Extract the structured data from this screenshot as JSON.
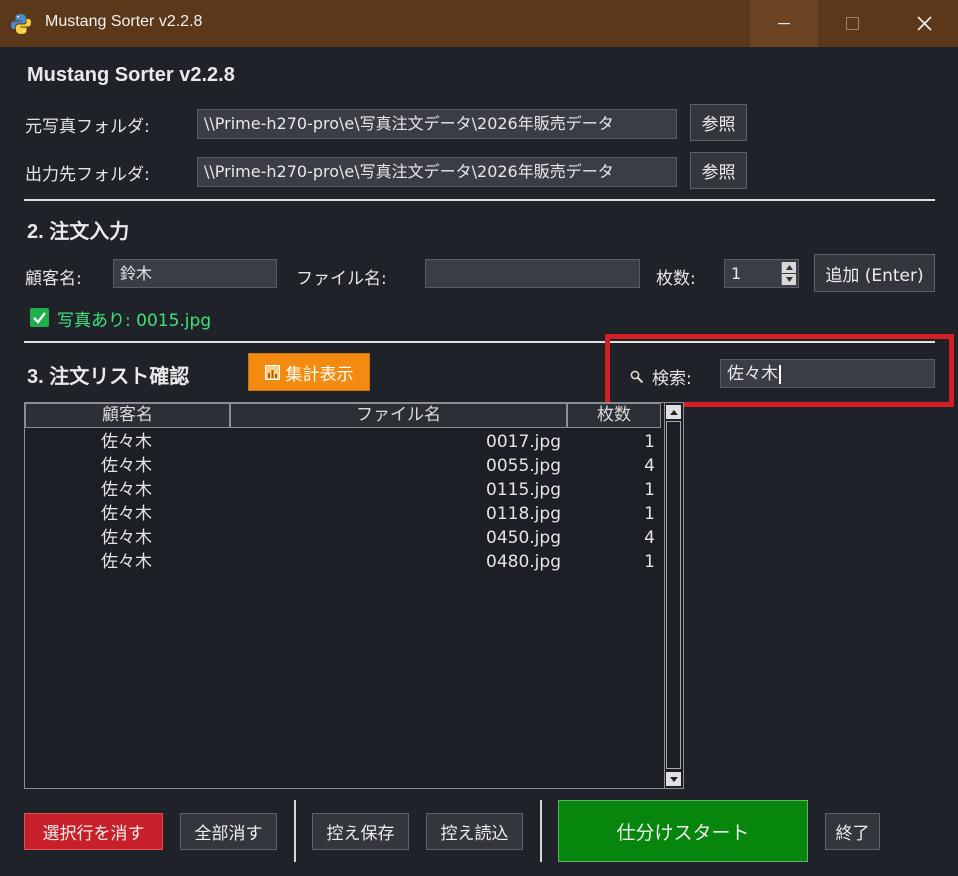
{
  "window": {
    "title": "Mustang Sorter v2.2.8"
  },
  "app": {
    "title": "Mustang Sorter v2.2.8"
  },
  "folders": {
    "source_label": "元写真フォルダ:",
    "source_value": "\\\\Prime-h270-pro\\e\\写真注文データ\\2026年販売データ",
    "output_label": "出力先フォルダ:",
    "output_value": "\\\\Prime-h270-pro\\e\\写真注文データ\\2026年販売データ",
    "browse_label": "参照"
  },
  "order_input": {
    "heading": "2. 注文入力",
    "customer_label": "顧客名:",
    "customer_value": "鈴木",
    "file_label": "ファイル名:",
    "file_value": "",
    "qty_label": "枚数:",
    "qty_value": "1",
    "add_label": "追加 (Enter)",
    "photo_status": "写真あり: 0015.jpg"
  },
  "order_list": {
    "heading": "3. 注文リスト確認",
    "summary_label": "集計表示",
    "search_label": "検索:",
    "search_value": "佐々木",
    "columns": [
      "顧客名",
      "ファイル名",
      "枚数"
    ],
    "rows": [
      {
        "customer": "佐々木",
        "file": "0017.jpg",
        "qty": "1"
      },
      {
        "customer": "佐々木",
        "file": "0055.jpg",
        "qty": "4"
      },
      {
        "customer": "佐々木",
        "file": "0115.jpg",
        "qty": "1"
      },
      {
        "customer": "佐々木",
        "file": "0118.jpg",
        "qty": "1"
      },
      {
        "customer": "佐々木",
        "file": "0450.jpg",
        "qty": "4"
      },
      {
        "customer": "佐々木",
        "file": "0480.jpg",
        "qty": "1"
      }
    ]
  },
  "actions": {
    "delete_selected": "選択行を消す",
    "delete_all": "全部消す",
    "save_backup": "控え保存",
    "load_backup": "控え読込",
    "start": "仕分けスタート",
    "exit": "終了"
  },
  "colors": {
    "titlebar": "#5a3819",
    "summary_button": "#f38b10",
    "start_button": "#06860c",
    "delete_button": "#c8202a",
    "highlight": "#d41f24",
    "status_text": "#3ee37a"
  },
  "icons": {
    "app": "python-logo-icon",
    "summary": "bar-chart-icon",
    "search": "magnifier-icon",
    "check": "checkmark-icon"
  }
}
